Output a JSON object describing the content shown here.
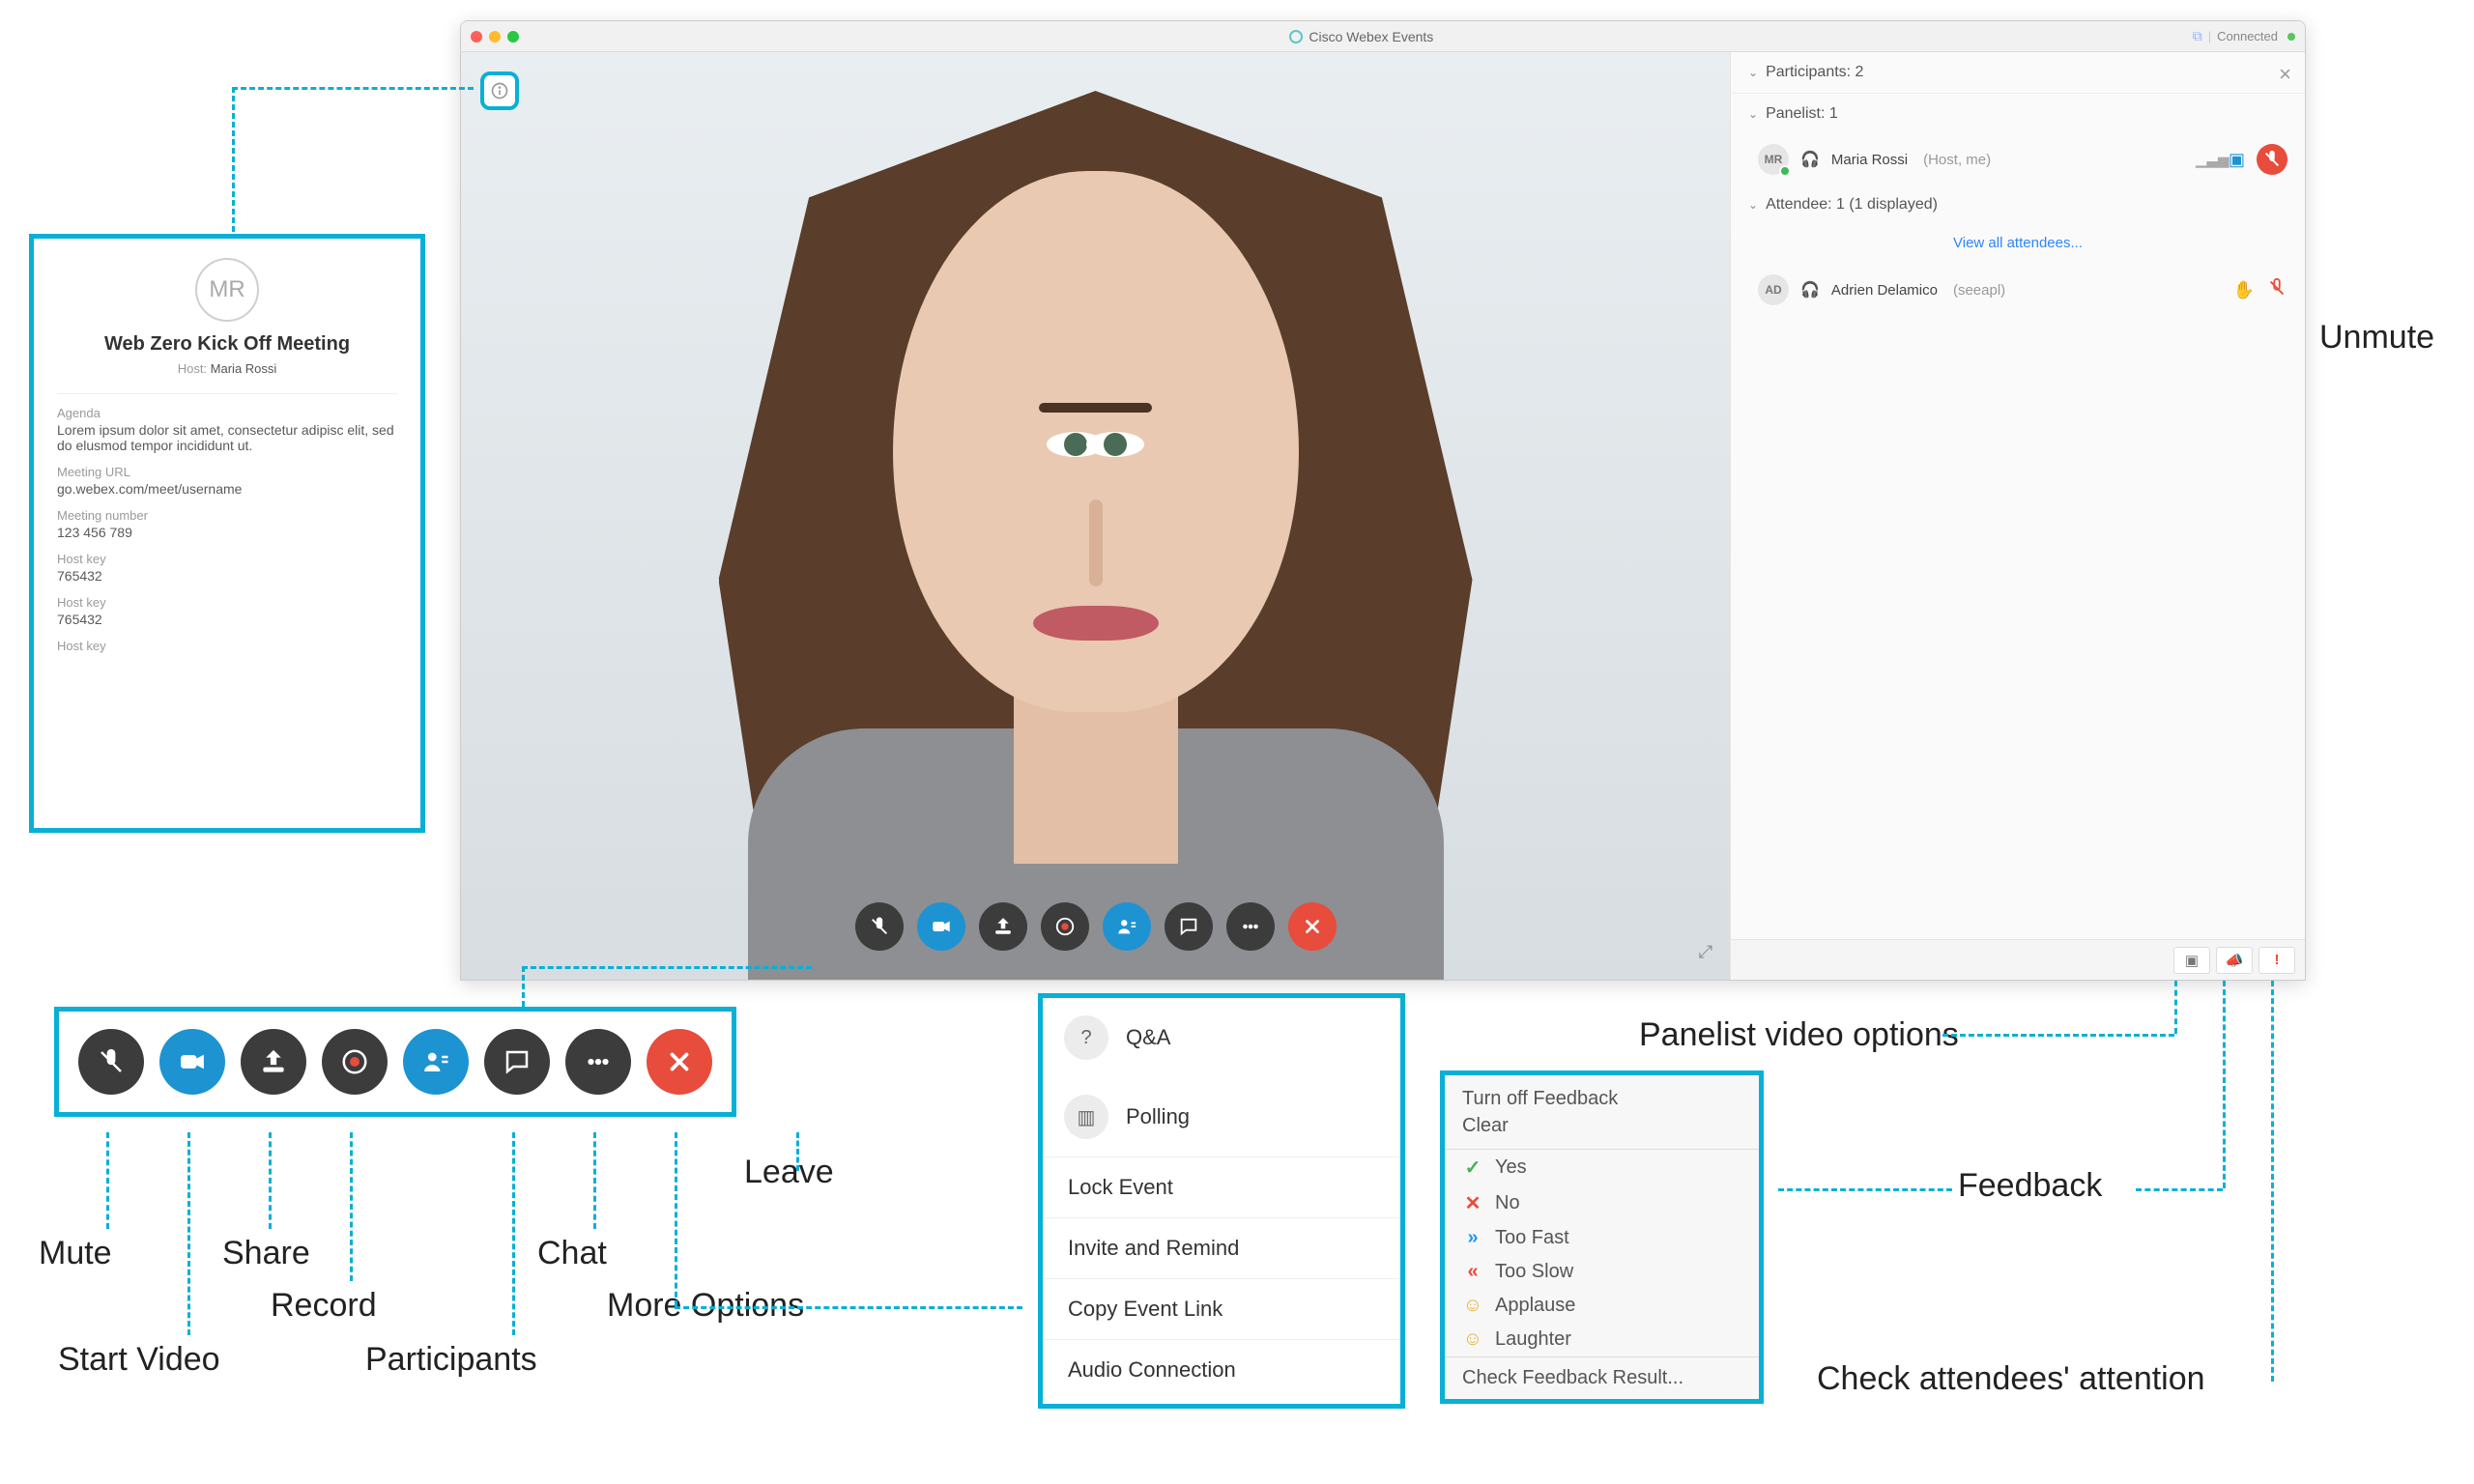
{
  "window": {
    "title": "Cisco Webex Events",
    "connected_label": "Connected"
  },
  "participants": {
    "header": "Participants: 2",
    "panelist_header": "Panelist: 1",
    "attendee_header": "Attendee: 1 (1 displayed)",
    "view_all": "View all attendees...",
    "panelist": {
      "initials": "MR",
      "name": "Maria Rossi",
      "suffix": "(Host, me)"
    },
    "attendee": {
      "initials": "AD",
      "name": "Adrien Delamico",
      "suffix": "(seeapl)"
    }
  },
  "info_card": {
    "initials": "MR",
    "title": "Web   Zero Kick Off Meeting",
    "host_label": "Host:",
    "host_name": "Maria Rossi",
    "agenda_label": "Agenda",
    "agenda_text": "Lorem ipsum dolor sit amet, consectetur adipisc elit, sed do elusmod tempor incididunt ut.",
    "url_label": "Meeting URL",
    "url_value": "go.webex.com/meet/username",
    "number_label": "Meeting number",
    "number_value": "123 456 789",
    "hostkey_label": "Host key",
    "hostkey_value": "765432",
    "hostkey2_label": "Host key",
    "hostkey2_value": "765432",
    "hostkey3_label": "Host key"
  },
  "toolbar_labels": {
    "mute": "Mute",
    "start_video": "Start Video",
    "share": "Share",
    "record": "Record",
    "participants": "Participants",
    "chat": "Chat",
    "more": "More Options",
    "leave": "Leave"
  },
  "menu": {
    "qa": "Q&A",
    "polling": "Polling",
    "lock": "Lock Event",
    "invite": "Invite and Remind",
    "copy": "Copy Event Link",
    "audio": "Audio Connection"
  },
  "feedback": {
    "hdr1": "Turn off Feedback",
    "hdr2": "Clear",
    "yes": "Yes",
    "no": "No",
    "fast": "Too Fast",
    "slow": "Too Slow",
    "applause": "Applause",
    "laugh": "Laughter",
    "check": "Check Feedback Result..."
  },
  "callouts": {
    "unmute": "Unmute",
    "panelist_video": "Panelist video options",
    "feedback": "Feedback",
    "attention": "Check attendees' attention"
  }
}
